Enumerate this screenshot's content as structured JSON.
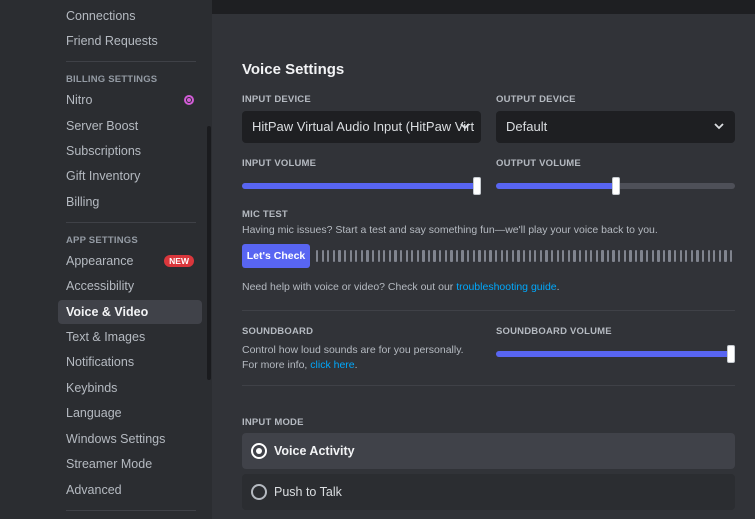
{
  "sidebar": {
    "user_items": [
      {
        "label": "Connections"
      },
      {
        "label": "Friend Requests"
      }
    ],
    "billing_header": "BILLING SETTINGS",
    "billing_items": [
      {
        "label": "Nitro"
      },
      {
        "label": "Server Boost"
      },
      {
        "label": "Subscriptions"
      },
      {
        "label": "Gift Inventory"
      },
      {
        "label": "Billing"
      }
    ],
    "app_header": "APP SETTINGS",
    "app_items": [
      {
        "label": "Appearance",
        "badge": "NEW"
      },
      {
        "label": "Accessibility"
      },
      {
        "label": "Voice & Video"
      },
      {
        "label": "Text & Images"
      },
      {
        "label": "Notifications"
      },
      {
        "label": "Keybinds"
      },
      {
        "label": "Language"
      },
      {
        "label": "Windows Settings"
      },
      {
        "label": "Streamer Mode"
      },
      {
        "label": "Advanced"
      }
    ]
  },
  "voice": {
    "title": "Voice Settings",
    "input_device_label": "INPUT DEVICE",
    "input_device_value": "HitPaw Virtual Audio Input (HitPaw Virt",
    "output_device_label": "OUTPUT DEVICE",
    "output_device_value": "Default",
    "input_volume_label": "INPUT VOLUME",
    "input_volume": 1.0,
    "output_volume_label": "OUTPUT VOLUME",
    "output_volume": 0.5,
    "mic_test_label": "MIC TEST",
    "mic_test_desc": "Having mic issues? Start a test and say something fun—we'll play your voice back to you.",
    "lets_check": "Let's Check",
    "help_text": "Need help with voice or video? Check out our ",
    "help_link": "troubleshooting guide",
    "help_end": "."
  },
  "soundboard": {
    "label": "SOUNDBOARD",
    "desc": "Control how loud sounds are for you personally. For more info, ",
    "link": "click here",
    "end": ".",
    "volume_label": "SOUNDBOARD VOLUME",
    "volume": 1.0
  },
  "input_mode": {
    "label": "INPUT MODE",
    "options": [
      {
        "label": "Voice Activity",
        "selected": true
      },
      {
        "label": "Push to Talk",
        "selected": false
      }
    ]
  },
  "colors": {
    "accent": "#5865f2",
    "danger": "#da373c",
    "link": "#00a8fc",
    "nitro": "#d15cd6"
  }
}
